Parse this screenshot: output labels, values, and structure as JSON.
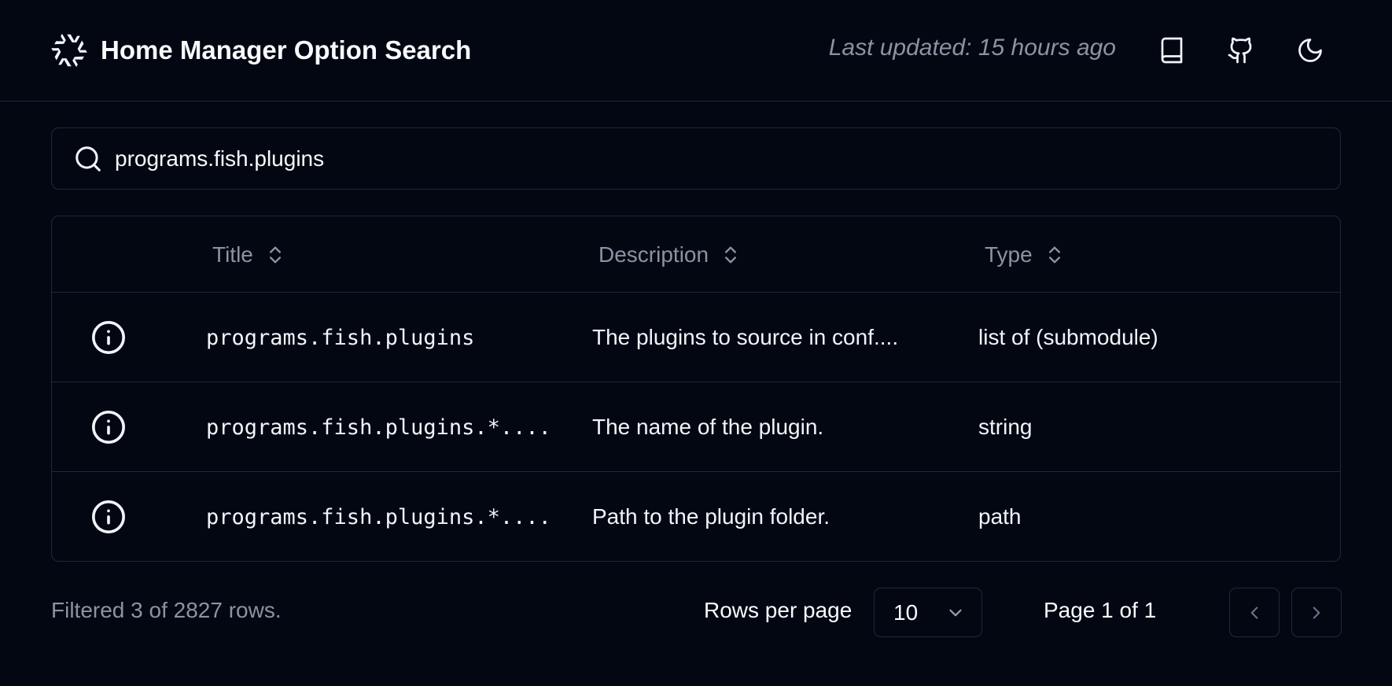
{
  "header": {
    "title": "Home Manager Option Search",
    "last_updated": "Last updated: 15 hours ago",
    "buttons": [
      {
        "icon": "book-icon"
      },
      {
        "icon": "github-icon"
      },
      {
        "icon": "moon-icon"
      }
    ]
  },
  "search": {
    "value": "programs.fish.plugins",
    "icon": "search-icon"
  },
  "table": {
    "columns": [
      "Title",
      "Description",
      "Type"
    ],
    "rows": [
      {
        "title": "programs.fish.plugins",
        "description": "The plugins to source in conf....",
        "type": "list of (submodule)"
      },
      {
        "title": "programs.fish.plugins.*....",
        "description": "The name of the plugin.",
        "type": "string"
      },
      {
        "title": "programs.fish.plugins.*....",
        "description": "Path to the plugin folder.",
        "type": "path"
      }
    ]
  },
  "footer": {
    "filtered": "Filtered 3 of 2827 rows.",
    "rows_per_page_label": "Rows per page",
    "rows_per_page_value": "10",
    "page_info": "Page 1 of 1"
  },
  "colors": {
    "background": "#030712",
    "border": "#1e293b",
    "muted_text": "#8b93a3",
    "text": "#f8fafc"
  }
}
